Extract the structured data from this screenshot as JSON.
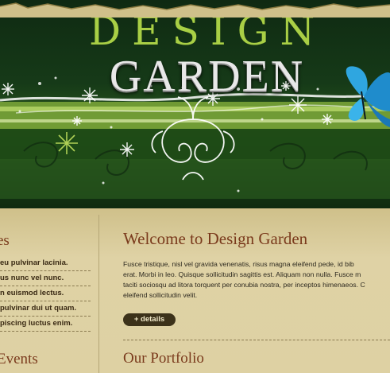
{
  "header": {
    "logo_top": "DESIGN",
    "logo_bottom": "GARDEN"
  },
  "sidebar": {
    "heading_top": "es",
    "items": [
      "eu pulvinar lacinia.",
      "us nunc vel nunc.",
      "n euismod lectus.",
      "pulvinar dui ut quam.",
      "piscing luctus enim."
    ],
    "heading_bottom": "Events"
  },
  "main": {
    "title": "Welcome to Design Garden",
    "paragraph_lines": [
      "Fusce tristique, nisl vel gravida venenatis, risus magna eleifend pede, id bib",
      "erat. Morbi in leo. Quisque sollicitudin sagittis est. Aliquam non nulla. Fusce m",
      "taciti sociosqu ad litora torquent per conubia nostra, per inceptos himenaeos. C",
      "eleifend sollicitudin velit."
    ],
    "details_label": "+ details",
    "portfolio_title": "Our Portfolio"
  },
  "colors": {
    "heading": "#7a3a1c",
    "logo_green": "#a9cf45",
    "button_bg": "#3c321a",
    "background": "#ded1a3"
  }
}
